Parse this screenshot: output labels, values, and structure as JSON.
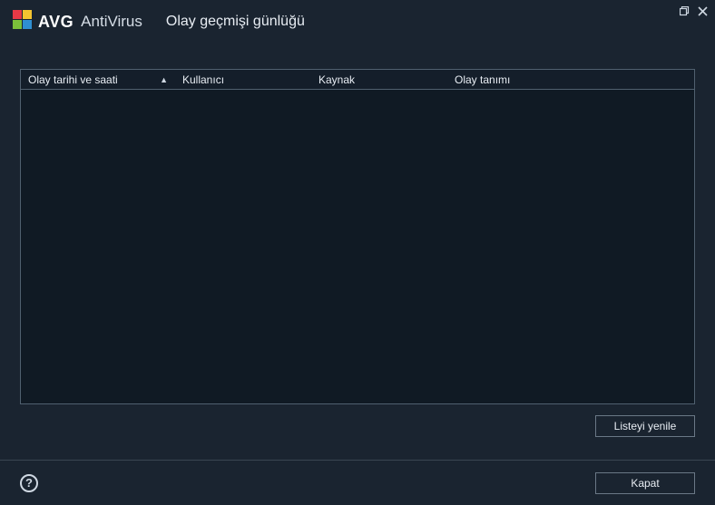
{
  "brand": {
    "name": "AVG",
    "product": "AntiVirus"
  },
  "window": {
    "title": "Olay geçmişi günlüğü"
  },
  "columns": {
    "col1": "Olay tarihi ve saati",
    "col2": "Kullanıcı",
    "col3": "Kaynak",
    "col4": "Olay tanımı"
  },
  "buttons": {
    "refresh": "Listeyi yenile",
    "close": "Kapat"
  },
  "icons": {
    "help": "?"
  }
}
